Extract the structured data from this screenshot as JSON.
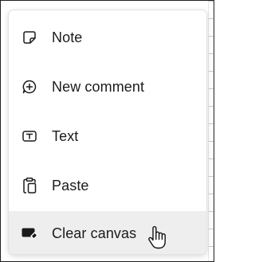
{
  "context_menu": {
    "items": [
      {
        "label": "Note",
        "icon": "sticky-note-icon"
      },
      {
        "label": "New comment",
        "icon": "comment-add-icon"
      },
      {
        "label": "Text",
        "icon": "text-box-icon"
      },
      {
        "label": "Paste",
        "icon": "clipboard-paste-icon"
      },
      {
        "label": "Clear canvas",
        "icon": "eraser-icon"
      }
    ],
    "hovered_index": 4
  },
  "colors": {
    "text": "#1b1b1b",
    "hover_background": "#eeeeee",
    "menu_background": "#ffffff"
  },
  "cursor": {
    "icon": "hand-pointer-cursor"
  }
}
